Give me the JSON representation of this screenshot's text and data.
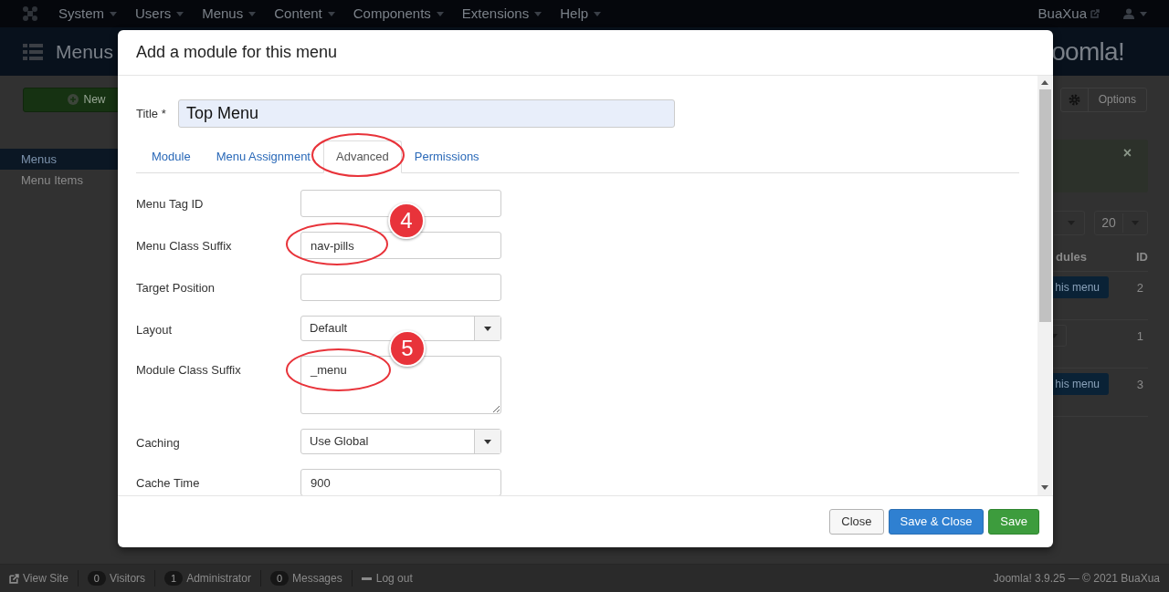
{
  "top_menu": {
    "items": [
      "System",
      "Users",
      "Menus",
      "Content",
      "Components",
      "Extensions",
      "Help"
    ],
    "site_link": "BuaXua"
  },
  "header": {
    "title": "Menus",
    "logo": "oomla!"
  },
  "toolbar": {
    "new_button": "New",
    "options_button": "Options"
  },
  "sidebar": {
    "items": [
      {
        "label": "Menus",
        "selected": true
      },
      {
        "label": "Menu Items",
        "selected": false
      }
    ]
  },
  "list": {
    "alert_close": "×",
    "limit": "20",
    "columns": [
      "dules",
      "ID"
    ],
    "rows": [
      {
        "kind": "button",
        "cell": "his menu",
        "id": "2"
      },
      {
        "kind": "dropdown",
        "id": "1"
      },
      {
        "kind": "button",
        "cell": "his menu",
        "id": "3"
      }
    ]
  },
  "modal": {
    "title": "Add a module for this menu",
    "title_field": {
      "label": "Title *",
      "value": "Top Menu"
    },
    "tabs": [
      {
        "label": "Module",
        "selected": false
      },
      {
        "label": "Menu Assignment",
        "selected": false
      },
      {
        "label": "Advanced",
        "selected": true
      },
      {
        "label": "Permissions",
        "selected": false
      }
    ],
    "fields": [
      {
        "kind": "text",
        "label": "Menu Tag ID"
      },
      {
        "kind": "text",
        "label": "Menu Class Suffix",
        "value": "nav-pills"
      },
      {
        "kind": "text",
        "label": "Target Position"
      },
      {
        "kind": "select",
        "label": "Layout",
        "value": "Default"
      },
      {
        "kind": "textarea",
        "label": "Module Class Suffix",
        "value": "_menu"
      },
      {
        "kind": "select",
        "label": "Caching",
        "value": "Use Global"
      },
      {
        "kind": "text",
        "label": "Cache Time",
        "value": "900"
      }
    ],
    "buttons": [
      {
        "label": "Close",
        "kind": "default"
      },
      {
        "label": "Save & Close",
        "kind": "primary"
      },
      {
        "label": "Save",
        "kind": "success"
      }
    ]
  },
  "annotations": [
    {
      "number": "4"
    },
    {
      "number": "5"
    }
  ],
  "status_bar": {
    "view_site": "View Site",
    "counters": [
      {
        "count": "0",
        "label": "Visitors"
      },
      {
        "count": "1",
        "label": "Administrator"
      },
      {
        "count": "0",
        "label": "Messages"
      }
    ],
    "logout": "Log out",
    "version": "Joomla! 3.9.25 — © 2021 BuaXua"
  }
}
